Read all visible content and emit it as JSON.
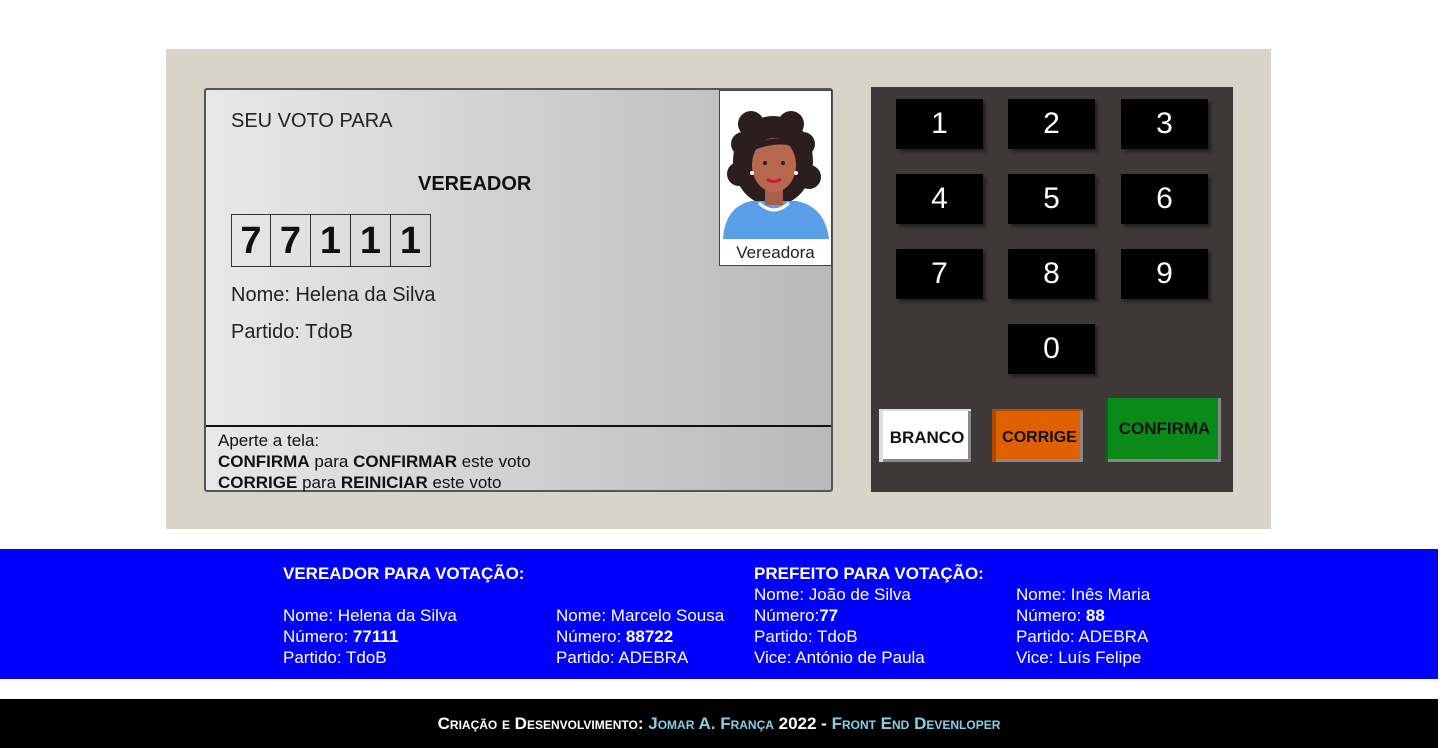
{
  "tela": {
    "seu_voto": "SEU VOTO PARA",
    "cargo": "VEREADOR",
    "digitos": [
      "7",
      "7",
      "1",
      "1",
      "1"
    ],
    "nome": "Nome: Helena da Silva",
    "partido": "Partido: TdoB",
    "foto_legenda": "Vereadora",
    "instrucoes": {
      "linha1": "Aperte a tela:",
      "confirma": "CONFIRMA",
      "para1": " para ",
      "confirmar": "CONFIRMAR",
      "este_voto1": " este voto",
      "corrige": "CORRIGE",
      "para2": " para ",
      "reiniciar": "REINICIAR",
      "este_voto2": " este voto"
    }
  },
  "teclado": {
    "teclas": [
      "1",
      "2",
      "3",
      "4",
      "5",
      "6",
      "7",
      "8",
      "9",
      "0"
    ],
    "branco": "BRANCO",
    "corrige": "CORRIGE",
    "confirma": "CONFIRMA"
  },
  "candidatos": {
    "vereador_titulo": "VEREADOR PARA VOTAÇÃO:",
    "vereador1": {
      "nome": "Nome: Helena da Silva",
      "numero_label": "Número: ",
      "numero": "77111",
      "partido": "Partido: TdoB"
    },
    "vereador2": {
      "nome": "Nome: Marcelo Sousa",
      "numero_label": "Número: ",
      "numero": "88722",
      "partido": "Partido: ADEBRA"
    },
    "prefeito_titulo": "PREFEITO PARA VOTAÇÃO:",
    "prefeito1": {
      "nome": "Nome: João de Silva",
      "numero_label": "Número:",
      "numero": "77",
      "partido": "Partido: TdoB",
      "vice": "Vice: António de Paula"
    },
    "prefeito2": {
      "nome": "Nome: Inês Maria",
      "numero_label": "Número: ",
      "numero": "88",
      "partido": "Partido: ADEBRA",
      "vice": "Vice: Luís Felipe"
    }
  },
  "footer": {
    "prefix": "Criação e Desenvolvimento: ",
    "autor": "Jomar A. França",
    "ano": " 2022 - ",
    "cargo": "Front End Devenloper"
  },
  "colors": {
    "faixa": "#0000ff",
    "confirma": "#0a8a18",
    "corrige": "#e06000",
    "branco": "#ffffff",
    "teclado": "#3e3838",
    "urna": "#d9d4c8"
  }
}
